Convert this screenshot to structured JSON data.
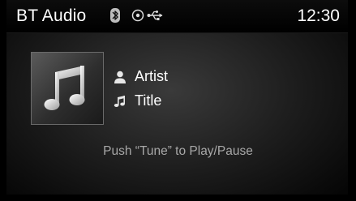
{
  "header": {
    "title": "BT Audio",
    "clock": "12:30",
    "status_icons": [
      "bluetooth-icon",
      "media-disc-icon",
      "usb-icon"
    ]
  },
  "track": {
    "artist": "Artist",
    "title": "Title",
    "album_art_icon": "music-note-icon"
  },
  "hint": "Push “Tune” to Play/Pause",
  "colors": {
    "background": "#000000",
    "text": "#ffffff",
    "hint_text": "#a8a8a8"
  }
}
